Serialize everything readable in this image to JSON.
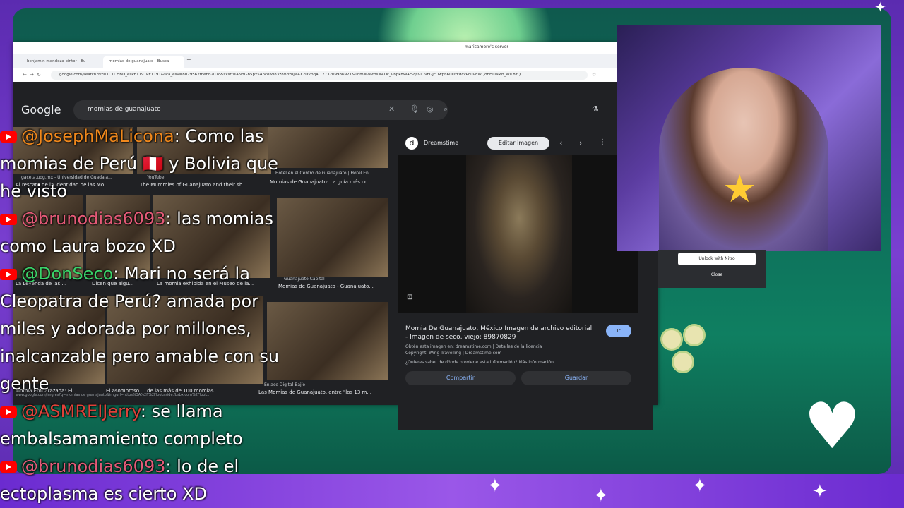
{
  "browser": {
    "screen_share_label": "maricamore's server",
    "tabs": [
      {
        "label": "benjamin mendoza pintor - Bu"
      },
      {
        "label": "momias de guanajuato - Busca"
      }
    ],
    "tab_add": "+",
    "url": "google.com/search?rlz=1C1CHBD_esPE1191PE1191&sca_esv=8029562fbebb207c&sxsrf=ANbL-n5px5AhcolW83z8Vdz8jw4X2DVpqA:1773209986921&udm=2&fbs=ADc_l-bpk8W4E-qsVlOvbGJcDwpn60DzFdcvPouv8WQohHLTaMb_WlL8zQ"
  },
  "google": {
    "logo": "Google",
    "query": "momias de guanajuato",
    "results": [
      {
        "source": "gaceta.udg.mx - Universidad de Guadala...",
        "title": "Al rescate de la identidad de las Mo..."
      },
      {
        "source": "YouTube",
        "title": "The Mummies of Guanajuato and their sh..."
      },
      {
        "source": "Hotel en el Centro de Guanajuato | Hotel En...",
        "title": "Momias de Guanajuato: La guía más co..."
      },
      {
        "source": "",
        "title": "La Leyenda de las ..."
      },
      {
        "source": "",
        "title": "Dicen que algu..."
      },
      {
        "source": "",
        "title": "La momia exhibida en el Museo de la..."
      },
      {
        "source": "Guanajuato Capital",
        "title": "Momias de Guanajuato - Guanajuato..."
      },
      {
        "source": "",
        "title": "Momia Embarazada: El..."
      },
      {
        "source": "",
        "title": "El asombroso ... de las más de 100 momias ..."
      },
      {
        "source": "Enlace Digital Bajío",
        "title": "Las Momias de Guanajuato, entre \"los 13 m..."
      }
    ],
    "status_url": "www.google.com/imgres?q=momias de guanajuato&imgurl=https%3A%2F%2Flookaside.fbsbx.com%2Flook..."
  },
  "preview": {
    "source": "Dreamstime",
    "edit_button": "Editar imagen",
    "title": "Momia De Guanajuato, México Imagen de archivo editorial - Imagen de seco, viejo: 89870829",
    "obtain_line": "Obtén esta imagen en: dreamstime.com | Detalles de la licencia",
    "copyright": "Copyright: Wing Travelling | Dreamstime.com",
    "more_info": "¿Quieres saber de dónde proviene esta información? Más información",
    "ir_button": "Ir",
    "share_button": "Compartir",
    "save_button": "Guardar"
  },
  "nitro": {
    "unlock_button": "Unlock with Nitro",
    "close_button": "Close"
  },
  "chat": [
    {
      "user": "@JosephMaLicona",
      "user_color": "#f0881c",
      "message": ": Como las momias de Perú 🇵🇪 y Bolivia que he visto"
    },
    {
      "user": "@brunodias6093",
      "user_color": "#e55a78",
      "message": ": las momias como Laura bozo XD"
    },
    {
      "user": "@DonSeco",
      "user_color": "#3ad36a",
      "message": ": Mari no será la Cleopatra de Perú? amada por miles y adorada por millones, inalcanzable pero amable con su gente"
    },
    {
      "user": "@ASMREIJerry",
      "user_color": "#e0413a",
      "message": ": se llama embalsamamiento completo"
    },
    {
      "user": "@brunodias6093",
      "user_color": "#e55a78",
      "message": ": lo de el ectoplasma es cierto XD"
    }
  ],
  "icons": {
    "youtube": "youtube-icon",
    "heart": "heart-icon",
    "star": "star-icon"
  }
}
